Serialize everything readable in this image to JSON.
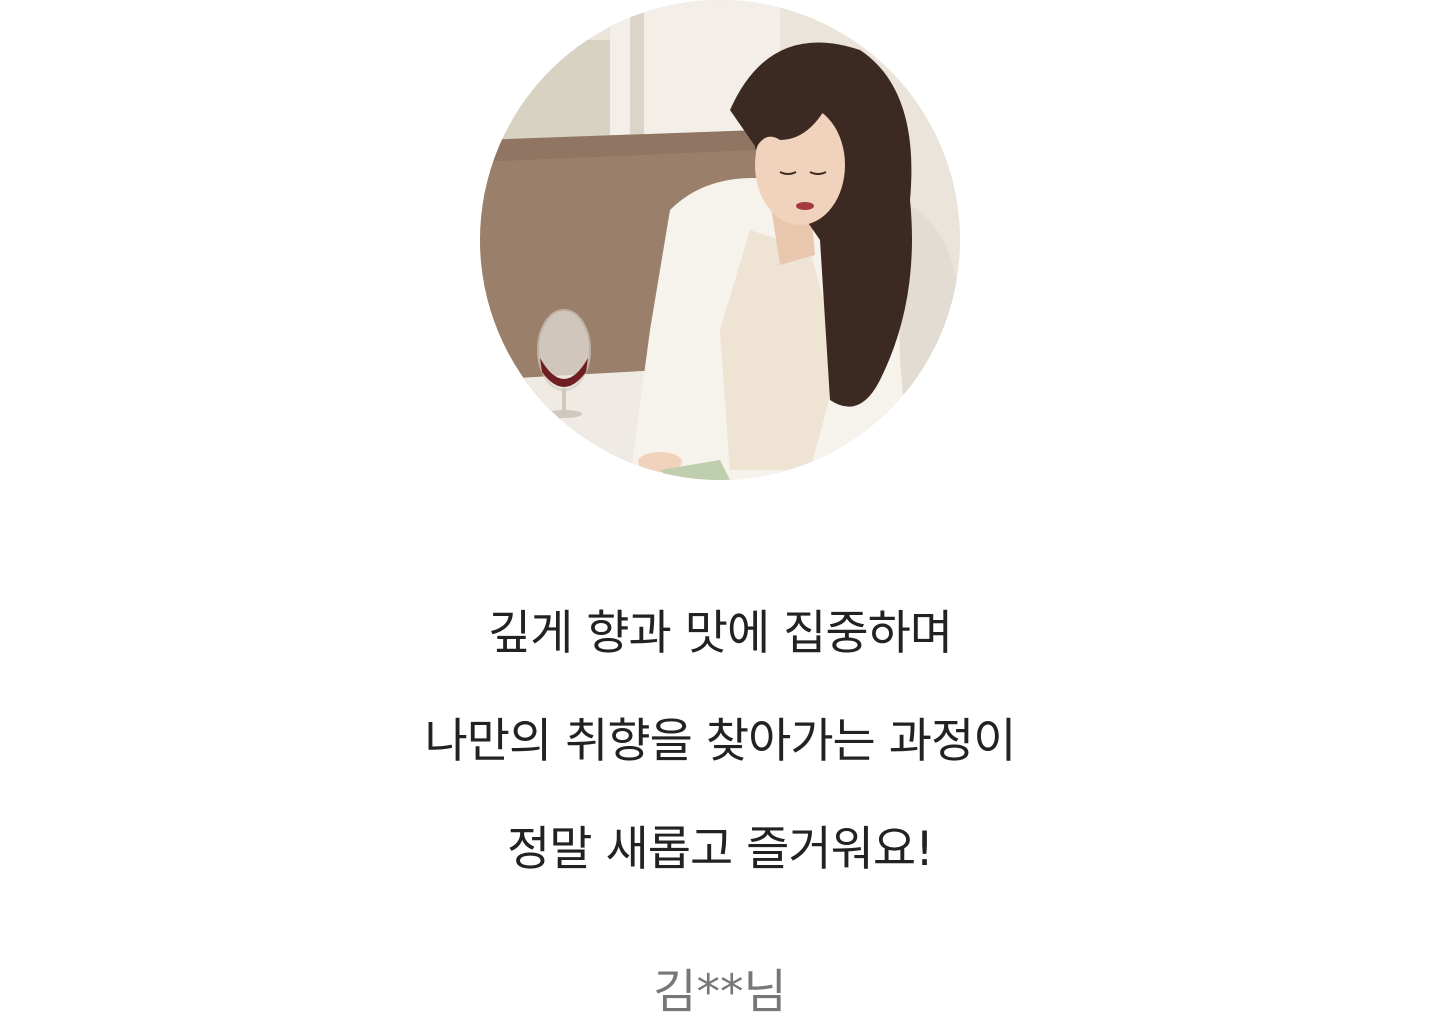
{
  "testimonial": {
    "photo_icon": "woman-reading-with-wine-photo",
    "quote_lines": [
      "깊게 향과 맛에 집중하며",
      "나만의 취향을 찾아가는 과정이",
      "정말 새롭고 즐거워요!"
    ],
    "author": "김**님"
  },
  "colors": {
    "quote_text": "#222222",
    "author_text": "#777777",
    "background": "#ffffff"
  }
}
